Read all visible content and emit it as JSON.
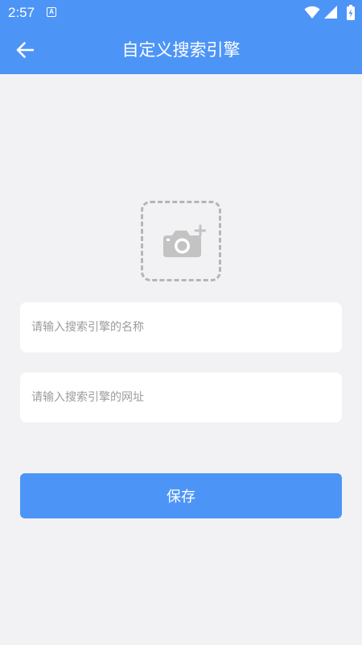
{
  "status_bar": {
    "time": "2:57",
    "notification_icon": "A"
  },
  "app_bar": {
    "title": "自定义搜索引擎",
    "back_icon": "arrow-left-icon"
  },
  "image_picker": {
    "icon": "camera-add-icon"
  },
  "form": {
    "name_field": {
      "value": "",
      "placeholder": "请输入搜索引擎的名称"
    },
    "url_field": {
      "value": "",
      "placeholder": "请输入搜索引擎的网址"
    },
    "save_label": "保存"
  },
  "colors": {
    "primary": "#4d94f7",
    "background": "#f2f2f4",
    "field_background": "#ffffff",
    "placeholder": "#9c9c9c",
    "dashed_border": "#b5b5b5"
  }
}
